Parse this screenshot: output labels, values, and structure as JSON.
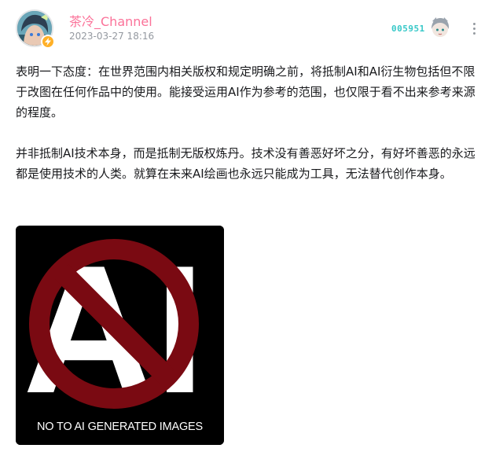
{
  "author": {
    "name": "茶冷_Channel",
    "time": "2023-03-27 18:16",
    "avatar_icon": "anime-character-avatar",
    "badge_icon": "lightning-icon",
    "badge_color": "#ffb027",
    "name_color": "#fb7299"
  },
  "fan_badge": {
    "number": "005951",
    "color": "#37c8c8"
  },
  "content": {
    "paragraphs": [
      "表明一下态度：在世界范围内相关版权和规定明确之前，将抵制AI和AI衍生物包括但不限于改图在任何作品中的使用。能接受运用AI作为参考的范围，也仅限于看不出来参考来源的程度。",
      "并非抵制AI技术本身，而是抵制无版权炼丹。技术没有善恶好坏之分，有好坏善恶的永远都是使用技术的人类。就算在未来AI绘画也永远只能成为工具，无法替代创作本身。"
    ]
  },
  "image": {
    "big_text": "AI",
    "caption": "NO TO AI GENERATED IMAGES",
    "prohibition_color": "#7a0a12"
  }
}
